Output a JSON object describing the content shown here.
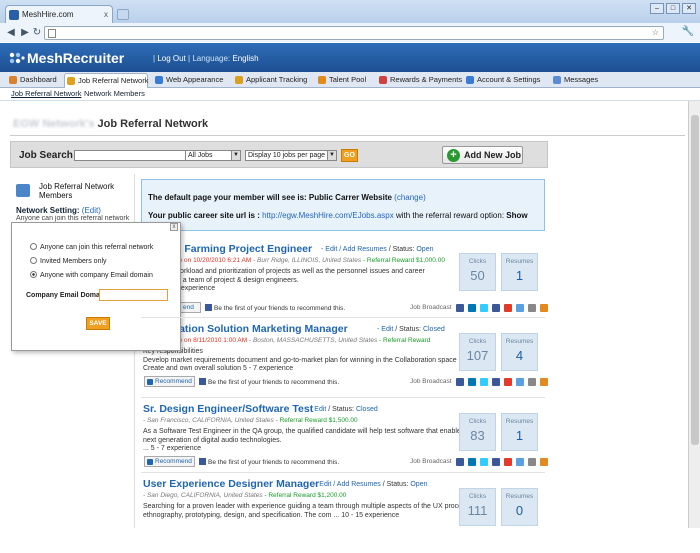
{
  "browser": {
    "tab_title": "MeshHire.com",
    "tab_close": "x",
    "url": "",
    "back": "◀",
    "forward": "▶",
    "reload": "↻",
    "bookmark": "☆",
    "wrench": "🔧",
    "window_min": "–",
    "window_max": "□",
    "window_close": "✕"
  },
  "header": {
    "logo": "MeshRecruiter",
    "welcome_prefix": "",
    "logout": "Log Out",
    "language_label": "Language:",
    "language": "English",
    "sep": "|"
  },
  "main_tabs": [
    {
      "label": "Dashboard",
      "color": "#d9822b"
    },
    {
      "label": "Job Referral Network",
      "color": "#e0a020"
    },
    {
      "label": "Web Appearance",
      "color": "#3a7bd5"
    },
    {
      "label": "Applicant Tracking",
      "color": "#d9a020"
    },
    {
      "label": "Talent Pool",
      "color": "#e08a20"
    },
    {
      "label": "Rewards & Payments",
      "color": "#d04040"
    },
    {
      "label": "Account & Settings",
      "color": "#3a7bd5"
    },
    {
      "label": "Messages",
      "color": "#5a8bd5"
    }
  ],
  "subnav": {
    "item1": "Job Referral Network",
    "item2": "Network Members"
  },
  "page": {
    "title_prefix": "EGW Network's",
    "title": "Job Referral Network"
  },
  "search": {
    "label": "Job Search :",
    "value": "",
    "filter": "All Jobs",
    "display": "Display 10 jobs per page",
    "go": "GO",
    "add_job": "Add New Job",
    "plus": "+"
  },
  "sidebar": {
    "title": "Job Referral Network Members",
    "setting_label": "Network Setting:",
    "edit": "(Edit)",
    "anyone_text": "Anyone can join this referral network"
  },
  "popup": {
    "close": "x",
    "options": [
      "Anyone can join this referral network",
      "Invited Members only",
      "Anyone with company Email domain"
    ],
    "selected_index": 2,
    "email_label": "Company Email Domain",
    "email_value": "",
    "save": "SAVE"
  },
  "info": {
    "line1": "The default page your member will see is: Public Carrer Website",
    "change": "(change)",
    "line2_label": "Your public career site url is :",
    "url": "http://egw.MeshHire.com/EJobs.aspx",
    "line2_suffix": "with the referral reward option:",
    "option": "Show"
  },
  "jobs": [
    {
      "title": "n Farming Project Engineer",
      "edit": "- Edit",
      "add_resumes": "/ Add Resumes",
      "status_label": "/ Status:",
      "status": "Open",
      "posted": "ne on 10/20/2010 6:21 AM",
      "location": "- Burr Ridge, ILLINOIS, United States",
      "reward": "- Referral Reward $1,000.00",
      "desc1": "workload and prioritization of projects as well as the personnel issues and career",
      "desc2": "of a team of project & design engineers.",
      "desc3": "0 experience",
      "recommend": "end",
      "first": "Be the first of your friends to recommend this.",
      "clicks_label": "Clicks",
      "clicks": "50",
      "resumes_label": "Resumes",
      "resumes": "1",
      "broadcast": "Job Broadcast"
    },
    {
      "title": "ration Solution Marketing Manager",
      "edit": "- Edit",
      "status_label": "/ Status:",
      "status": "Closed",
      "posted": "ne on 8/11/2010 1:00 AM",
      "location": "- Boston, MASSACHUSETTS, United States",
      "reward": "- Referral Reward",
      "desc1": "Key responsibilities",
      "desc2": "Develop market requirements document and go-to-market plan for winning in the Collaboration space",
      "desc3": "Create and own overall solution 5 - 7 experience",
      "recommend": "Recommend",
      "first": "Be the first of your friends to recommend this.",
      "clicks_label": "Clicks",
      "clicks": "107",
      "resumes_label": "Resumes",
      "resumes": "4",
      "broadcast": "Job Broadcast"
    },
    {
      "title": "Sr. Design Engineer/Software Test",
      "edit": "- Edit",
      "status_label": "/ Status:",
      "status": "Closed",
      "location": "- San Francisco, CALIFORNIA, United States",
      "reward": "- Referral Reward $1,500.00",
      "desc1": "As a Software Test Engineer in the QA group, the qualified candidate will help test software that enables the",
      "desc2": "next generation of digital audio technologies.",
      "desc3": "... 5 - 7 experience",
      "recommend": "Recommend",
      "first": "Be the first of your friends to recommend this.",
      "clicks_label": "Clicks",
      "clicks": "83",
      "resumes_label": "Resumes",
      "resumes": "1",
      "broadcast": "Job Broadcast"
    },
    {
      "title": "User Experience Designer Manager",
      "edit": "- Edit",
      "add_resumes": "/ Add Resumes",
      "status_label": "/ Status:",
      "status": "Open",
      "location": "- San Diego, CALIFORNIA, United States",
      "reward": "- Referral Reward $1,200.00",
      "desc1": "Searching for a proven leader with experience guiding a team through multiple aspects of the UX process:",
      "desc2": "ethnography, prototyping, design, and specification. The com ... 10 - 15 experience",
      "clicks_label": "Clicks",
      "clicks": "111",
      "resumes_label": "Resumes",
      "resumes": "0"
    }
  ],
  "social_colors": [
    "#3b5998",
    "#0077b5",
    "#33ccff",
    "#3b5998",
    "#e03b2b",
    "#5aa0e0",
    "#888888",
    "#e08a20"
  ]
}
